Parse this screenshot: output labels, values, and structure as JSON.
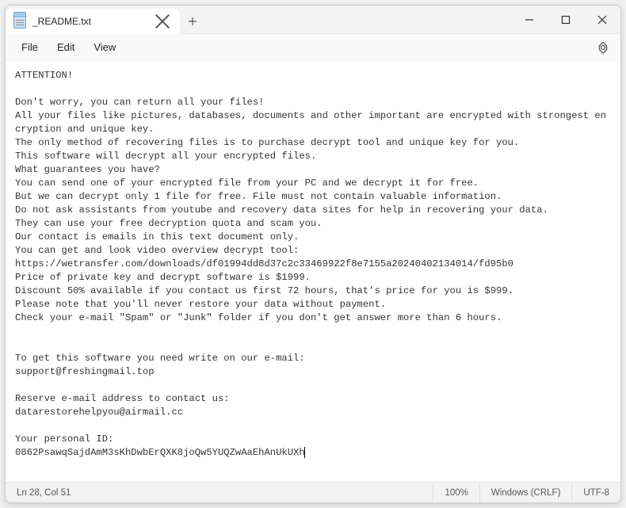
{
  "tab": {
    "title": "_README.txt"
  },
  "menu": {
    "file": "File",
    "edit": "Edit",
    "view": "View"
  },
  "document": {
    "text": "ATTENTION!\n\nDon't worry, you can return all your files!\nAll your files like pictures, databases, documents and other important are encrypted with strongest encryption and unique key.\nThe only method of recovering files is to purchase decrypt tool and unique key for you.\nThis software will decrypt all your encrypted files.\nWhat guarantees you have?\nYou can send one of your encrypted file from your PC and we decrypt it for free.\nBut we can decrypt only 1 file for free. File must not contain valuable information.\nDo not ask assistants from youtube and recovery data sites for help in recovering your data.\nThey can use your free decryption quota and scam you.\nOur contact is emails in this text document only.\nYou can get and look video overview decrypt tool:\nhttps://wetransfer.com/downloads/df01994dd8d37c2c33469922f8e7155a20240402134014/fd95b0\nPrice of private key and decrypt software is $1999.\nDiscount 50% available if you contact us first 72 hours, that's price for you is $999.\nPlease note that you'll never restore your data without payment.\nCheck your e-mail \"Spam\" or \"Junk\" folder if you don't get answer more than 6 hours.\n\n\nTo get this software you need write on our e-mail:\nsupport@freshingmail.top\n\nReserve e-mail address to contact us:\ndatarestorehelpyou@airmail.cc\n\nYour personal ID:\n0862PsawqSajdAmM3sKhDwbErQXK8joQw5YUQZwAaEhAnUkUXh"
  },
  "status": {
    "position": "Ln 28, Col 51",
    "zoom": "100%",
    "lineending": "Windows (CRLF)",
    "encoding": "UTF-8"
  }
}
